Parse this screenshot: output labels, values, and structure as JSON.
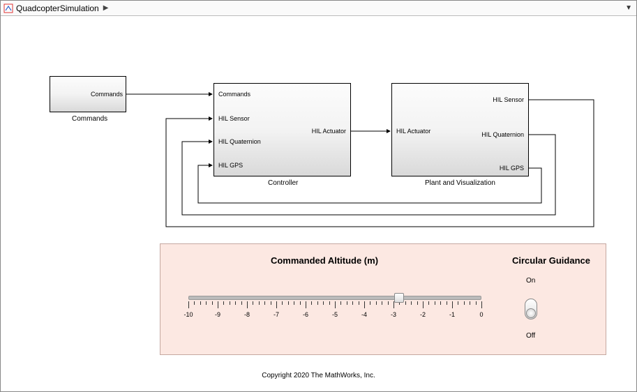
{
  "titlebar": {
    "title": "QuadcopterSimulation"
  },
  "blocks": {
    "commands": {
      "label": "Commands",
      "ports": {
        "out1": "Commands"
      }
    },
    "controller": {
      "label": "Controller",
      "inports": {
        "p1": "Commands",
        "p2": "HIL Sensor",
        "p3": "HIL Quaternion",
        "p4": "HIL GPS"
      },
      "outports": {
        "p1": "HIL Actuator"
      }
    },
    "plant": {
      "label": "Plant and Visualization",
      "inports": {
        "p1": "HIL Actuator"
      },
      "outports": {
        "p1": "HIL Sensor",
        "p2": "HIL Quaternion",
        "p3": "HIL GPS"
      }
    }
  },
  "panel": {
    "altitude": {
      "title": "Commanded Altitude (m)",
      "min": -10,
      "max": 0,
      "value": -2.8,
      "ticks": [
        -10,
        -9,
        -8,
        -7,
        -6,
        -5,
        -4,
        -3,
        -2,
        -1,
        0
      ]
    },
    "guidance": {
      "title": "Circular Guidance",
      "on_label": "On",
      "off_label": "Off",
      "state": "off"
    }
  },
  "copyright": "Copyright 2020 The MathWorks, Inc."
}
